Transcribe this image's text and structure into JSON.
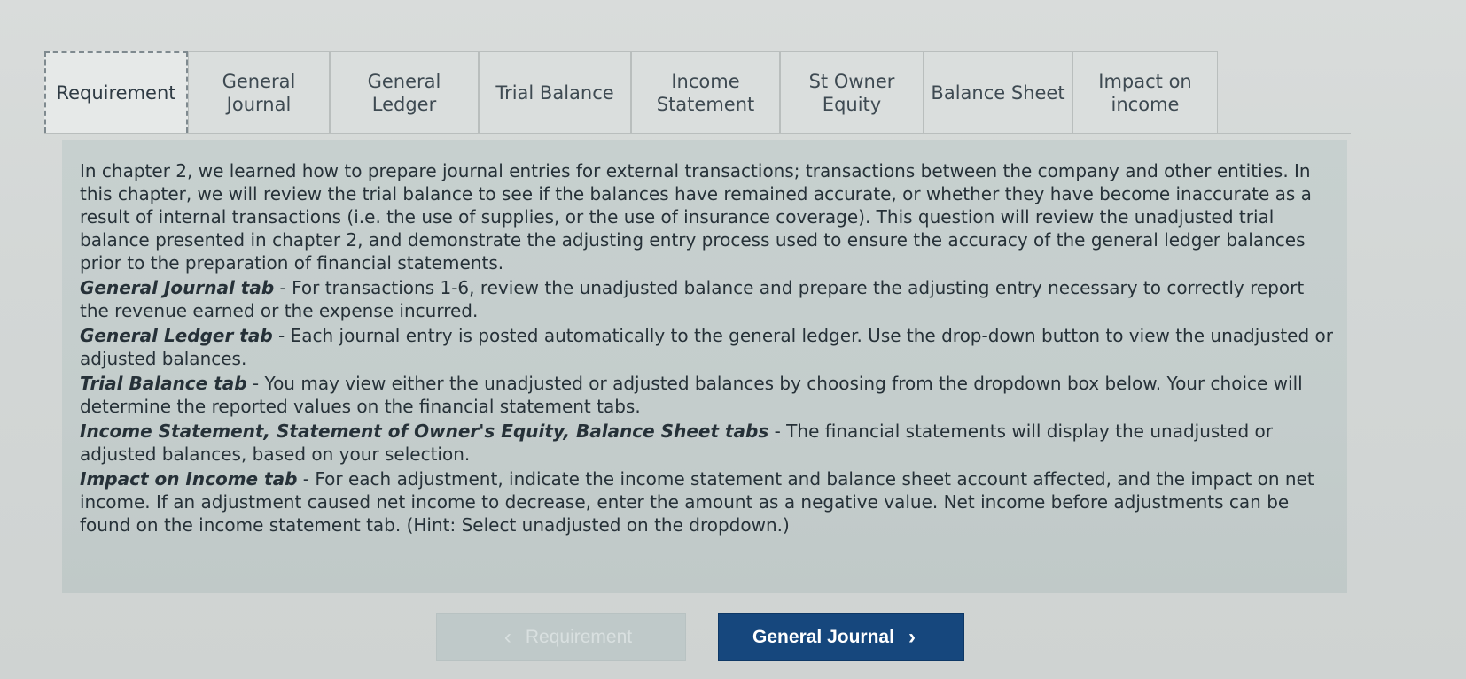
{
  "tabs": [
    {
      "label": "Requirement",
      "active": true
    },
    {
      "label": "General\nJournal"
    },
    {
      "label": "General\nLedger"
    },
    {
      "label": "Trial Balance"
    },
    {
      "label": "Income\nStatement"
    },
    {
      "label": "St Owner\nEquity"
    },
    {
      "label": "Balance Sheet"
    },
    {
      "label": "Impact on\nincome"
    }
  ],
  "content": {
    "intro": "In chapter 2, we learned how to prepare journal entries for external transactions; transactions between the company and other entities. In this chapter, we will review the trial balance to see if the balances have remained accurate, or whether they have become inaccurate as a result of internal transactions (i.e. the use of supplies, or the use of insurance coverage). This question will review the unadjusted trial balance presented in chapter 2, and demonstrate the adjusting entry process used to ensure the accuracy of the general ledger balances prior to the preparation of financial statements.",
    "items": [
      {
        "title": "General Journal tab",
        "text": " - For transactions 1-6, review the unadjusted balance and prepare the adjusting entry necessary to correctly report the revenue earned or the expense incurred."
      },
      {
        "title": "General Ledger tab",
        "text": " - Each journal entry is posted automatically to the general ledger. Use the drop-down button to view the unadjusted or adjusted balances."
      },
      {
        "title": "Trial Balance tab",
        "text": " - You may view either the unadjusted or adjusted balances by choosing from the dropdown box below. Your choice will determine the reported values on the financial statement tabs."
      },
      {
        "title": "Income Statement, Statement of Owner's Equity, Balance Sheet tabs",
        "text": " - The financial statements will display the unadjusted or adjusted balances, based on your selection."
      },
      {
        "title": "Impact on Income tab",
        "text": " - For each adjustment, indicate the income statement and balance sheet account affected, and the impact on net income. If an adjustment caused net income to decrease, enter the amount as a negative value. Net income before adjustments can be found on the income statement tab. (Hint: Select unadjusted on the dropdown.)"
      }
    ]
  },
  "nav": {
    "prev_label": "Requirement",
    "prev_icon": "chevron-left-icon",
    "next_label": "General Journal",
    "next_icon": "chevron-right-icon"
  }
}
